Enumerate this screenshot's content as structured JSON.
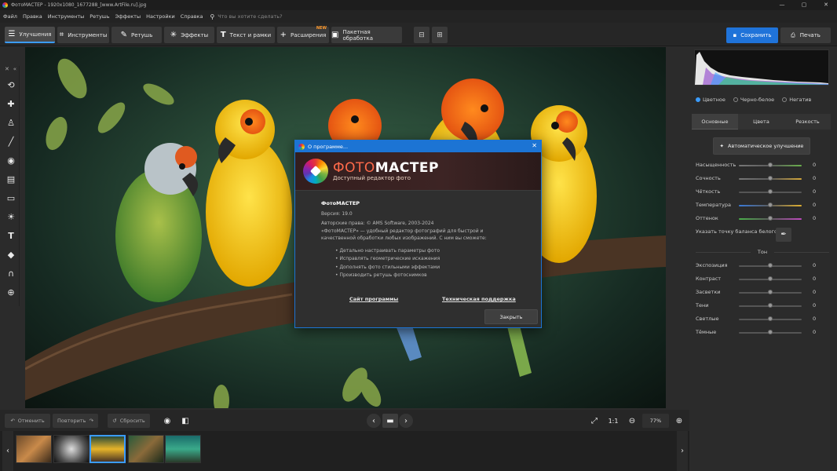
{
  "window": {
    "title": "ФотоМАСТЕР - 1920x1080_1677288_[www.ArtFile.ru].jpg"
  },
  "menu": {
    "items": [
      "Файл",
      "Правка",
      "Инструменты",
      "Ретушь",
      "Эффекты",
      "Настройки",
      "Справка"
    ],
    "search_placeholder": "Что вы хотите сделать?"
  },
  "toolbar": {
    "tabs": [
      {
        "label": "Улучшения",
        "icon": "sliders-icon"
      },
      {
        "label": "Инструменты",
        "icon": "crop-icon"
      },
      {
        "label": "Ретушь",
        "icon": "brush-icon"
      },
      {
        "label": "Эффекты",
        "icon": "sparkle-icon"
      },
      {
        "label": "Текст и рамки",
        "icon": "text-icon"
      },
      {
        "label": "Расширения",
        "icon": "plus-icon",
        "badge": "NEW"
      },
      {
        "label": "Пакетная обработка",
        "icon": "batch-icon"
      }
    ],
    "save_label": "Сохранить",
    "print_label": "Печать"
  },
  "dialog": {
    "title": "О программе...",
    "brand_a": "ФОТО",
    "brand_b": "МАСТЕР",
    "brand_sub": "Доступный редактор фото",
    "product_name": "ФотоМАСТЕР",
    "version": "Версия: 19.0",
    "copyright": "Авторские права: © AMS Software, 2003-2024",
    "desc1": "«ФотоМАСТЕР» — удобный редактор фотографий для быстрой и",
    "desc2": "качественной обработки любых изображений. С ним вы сможете:",
    "features": [
      "Детально настраивать параметры фото",
      "Исправлять геометрические искажения",
      "Дополнять фото стильными эффектами",
      "Производить ретушь фотоснимков"
    ],
    "link_site": "Сайт программы",
    "link_support": "Техническая поддержка",
    "close_label": "Закрыть"
  },
  "right_panel": {
    "modes": [
      "Цветное",
      "Черно-белое",
      "Негатив"
    ],
    "tabs": [
      "Основные",
      "Цвета",
      "Резкость"
    ],
    "auto_button": "Автоматическое улучшение",
    "sliders_basic": [
      {
        "label": "Насыщенность",
        "value": "0"
      },
      {
        "label": "Сочность",
        "value": "0"
      },
      {
        "label": "Чёткость",
        "value": "0"
      },
      {
        "label": "Температура",
        "value": "0"
      },
      {
        "label": "Оттенок",
        "value": "0"
      }
    ],
    "white_balance_label": "Указать точку баланса белого",
    "tone_header": "Тон",
    "sliders_tone": [
      {
        "label": "Экспозиция",
        "value": "0"
      },
      {
        "label": "Контраст",
        "value": "0"
      },
      {
        "label": "Засветки",
        "value": "0"
      },
      {
        "label": "Тени",
        "value": "0"
      },
      {
        "label": "Светлые",
        "value": "0"
      },
      {
        "label": "Тёмные",
        "value": "0"
      }
    ]
  },
  "bottom": {
    "undo_label": "Отменить",
    "redo_label": "Повторить",
    "reset_label": "Сбросить",
    "ratio_label": "1:1",
    "zoom_value": "77%"
  },
  "colors": {
    "accent": "#1f73d9",
    "badge": "#ff9a2e"
  }
}
